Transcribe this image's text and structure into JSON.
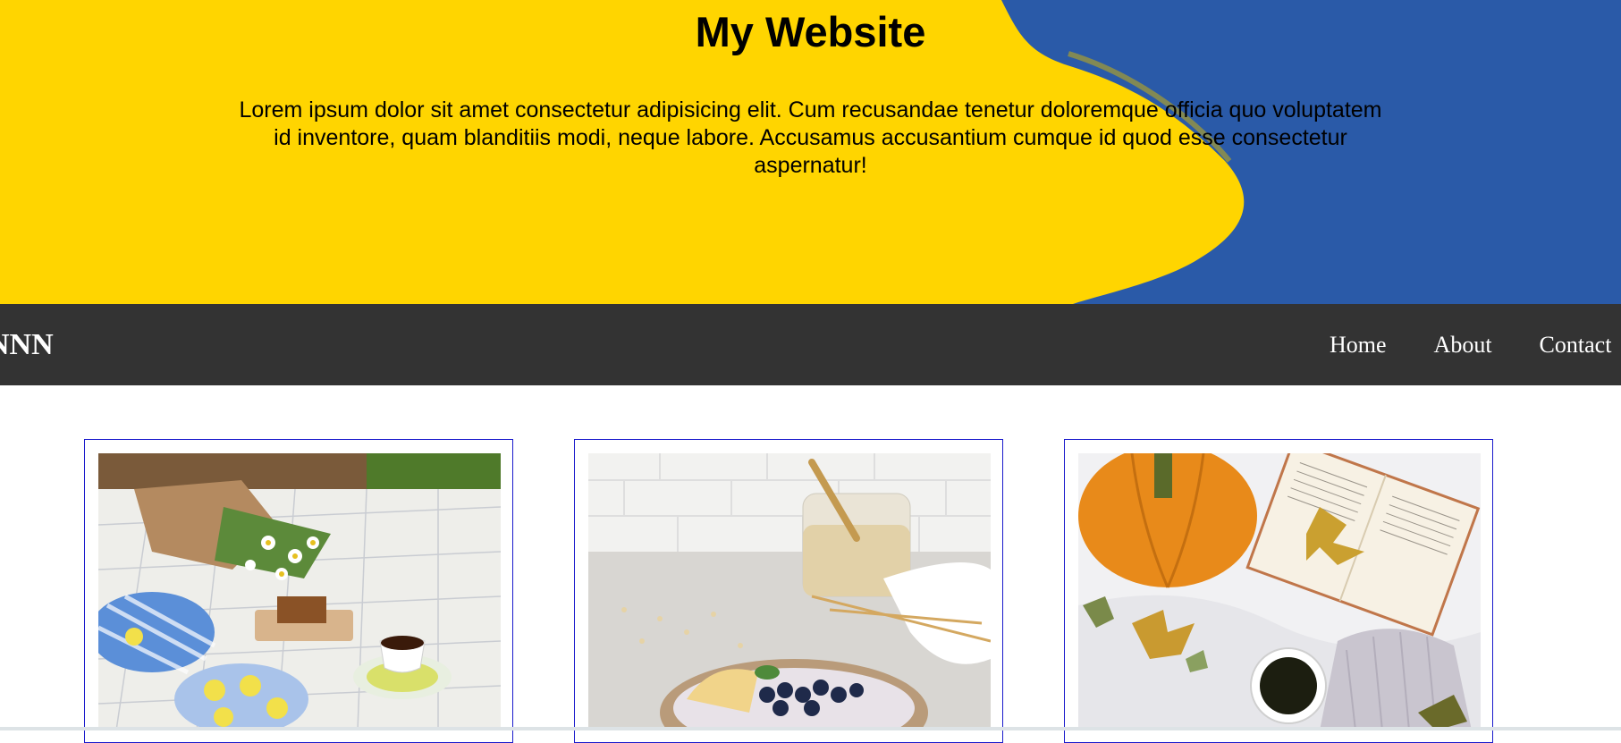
{
  "hero": {
    "title": "My Website",
    "text": "Lorem ipsum dolor sit amet consectetur adipisicing elit. Cum recusandae tenetur doloremque officia quo voluptatem id inventore, quam blanditiis modi, neque labore. Accusamus accusantium cumque id quod esse consectetur aspernatur!",
    "colors": {
      "yellow": "#ffd500",
      "blue": "#2a5aa8"
    }
  },
  "navbar": {
    "brand": "NNN",
    "links": [
      {
        "label": "Home"
      },
      {
        "label": "About"
      },
      {
        "label": "Contact"
      }
    ],
    "background": "#333333"
  },
  "cards": [
    {
      "image": "picnic-with-daisies-and-tea-photo"
    },
    {
      "image": "oatmeal-bowl-with-blueberries-photo"
    },
    {
      "image": "pumpkin-book-autumn-leaves-photo"
    }
  ],
  "card_border_color": "#1a1acc"
}
